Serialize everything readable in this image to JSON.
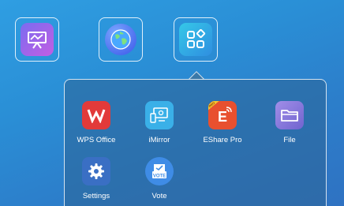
{
  "dock": [
    {
      "icon": "whiteboard-icon"
    },
    {
      "icon": "browser-globe-icon"
    },
    {
      "icon": "apps-grid-icon"
    }
  ],
  "apps": [
    {
      "label": "WPS Office",
      "icon": "wps-office-icon",
      "color": "#e23a3a"
    },
    {
      "label": "iMirror",
      "icon": "imirror-icon",
      "color": "#3ab0e8"
    },
    {
      "label": "EShare Pro",
      "icon": "eshare-pro-icon",
      "color": "#e8502f",
      "badge": "PRO"
    },
    {
      "label": "File",
      "icon": "folder-icon",
      "color": "#8a7fd6"
    },
    {
      "label": "Settings",
      "icon": "gear-icon",
      "color": "#3a6fc4"
    },
    {
      "label": "Vote",
      "icon": "vote-icon",
      "color": "#3f8ce6",
      "badge": "VOTE"
    }
  ]
}
